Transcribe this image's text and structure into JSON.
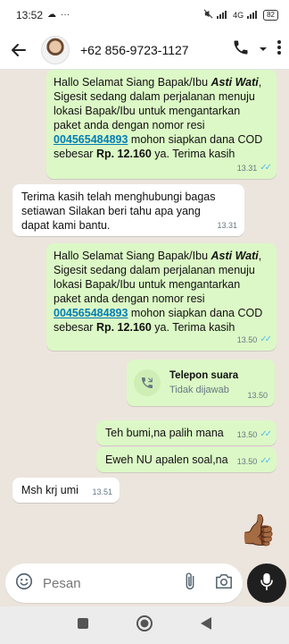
{
  "status_bar": {
    "time": "13:52",
    "left_icons": [
      "cloud-icon",
      "more-dots-icon"
    ],
    "right_text": "4G",
    "battery": "82"
  },
  "header": {
    "contact": "+62 856-9723-1127"
  },
  "messages": [
    {
      "direction": "outgoing",
      "line1_pre": "Hallo Selamat Siang Bapak/Ibu ",
      "line1_name": "Asti Wati",
      "line1_post": ",",
      "body_a": "Sigesit sedang dalam perjalanan menuju lokasi Bapak/Ibu untuk mengantarkan paket anda dengan nomor resi",
      "resi": "004565484893",
      "body_b": " mohon siapkan dana COD sebesar ",
      "amount": "Rp. 12.160",
      "body_c": " ya. Terima kasih",
      "time": "13.31"
    },
    {
      "direction": "incoming",
      "text": "Terima kasih telah menghubungi bagas setiawan Silakan beri tahu apa yang dapat kami bantu.",
      "time": "13.31"
    },
    {
      "direction": "outgoing",
      "line1_pre": "Hallo Selamat Siang Bapak/Ibu ",
      "line1_name": "Asti Wati",
      "line1_post": ",",
      "body_a": "Sigesit sedang dalam perjalanan menuju lokasi Bapak/Ibu untuk mengantarkan paket anda dengan nomor resi",
      "resi": "004565484893",
      "body_b": " mohon siapkan dana COD sebesar ",
      "amount": "Rp. 12.160",
      "body_c": " ya. Terima kasih",
      "time": "13.50"
    },
    {
      "direction": "outgoing",
      "call_title": "Telepon suara",
      "call_status": "Tidak dijawab",
      "time": "13.50"
    },
    {
      "direction": "outgoing",
      "text": "Teh bumi,na palih mana",
      "time": "13.50"
    },
    {
      "direction": "outgoing",
      "text": "Eweh NU apalen soal,na",
      "time": "13.50"
    },
    {
      "direction": "incoming",
      "text": "Msh krj umi",
      "time": "13.51"
    },
    {
      "direction": "outgoing",
      "emoji": "👍🏾"
    }
  ],
  "composer": {
    "placeholder": "Pesan"
  },
  "colors": {
    "outgoing_bubble": "#dcf8c6",
    "incoming_bubble": "#ffffff",
    "link": "#027eb5",
    "read_tick": "#53bdeb",
    "background": "#ece5dd"
  }
}
